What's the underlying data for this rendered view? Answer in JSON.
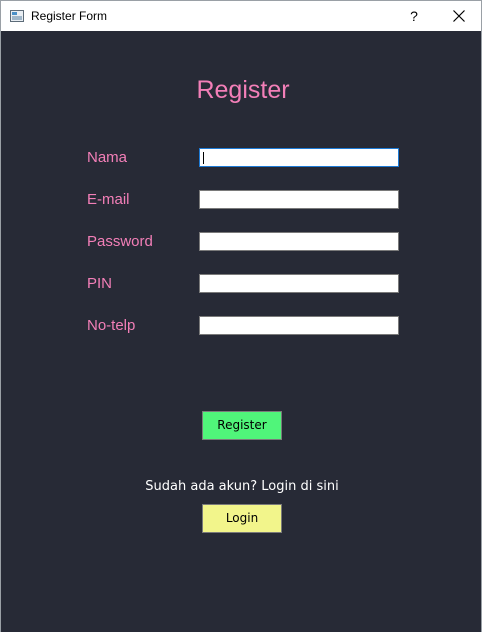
{
  "window": {
    "title": "Register Form",
    "help_glyph": "?",
    "close_icon": "close-icon",
    "app_icon": "window-app-icon"
  },
  "form": {
    "heading": "Register",
    "fields": [
      {
        "label": "Nama",
        "value": "",
        "focused": true
      },
      {
        "label": "E-mail",
        "value": ""
      },
      {
        "label": "Password",
        "value": ""
      },
      {
        "label": "PIN",
        "value": ""
      },
      {
        "label": "No-telp",
        "value": ""
      }
    ],
    "register_button": "Register",
    "login_prompt": "Sudah ada akun? Login di sini",
    "login_button": "Login"
  },
  "colors": {
    "background": "#272a36",
    "accent_text": "#f37fb8",
    "register_button": "#50f57a",
    "login_button": "#f2f58b",
    "focus_border": "#1e7bd6"
  }
}
